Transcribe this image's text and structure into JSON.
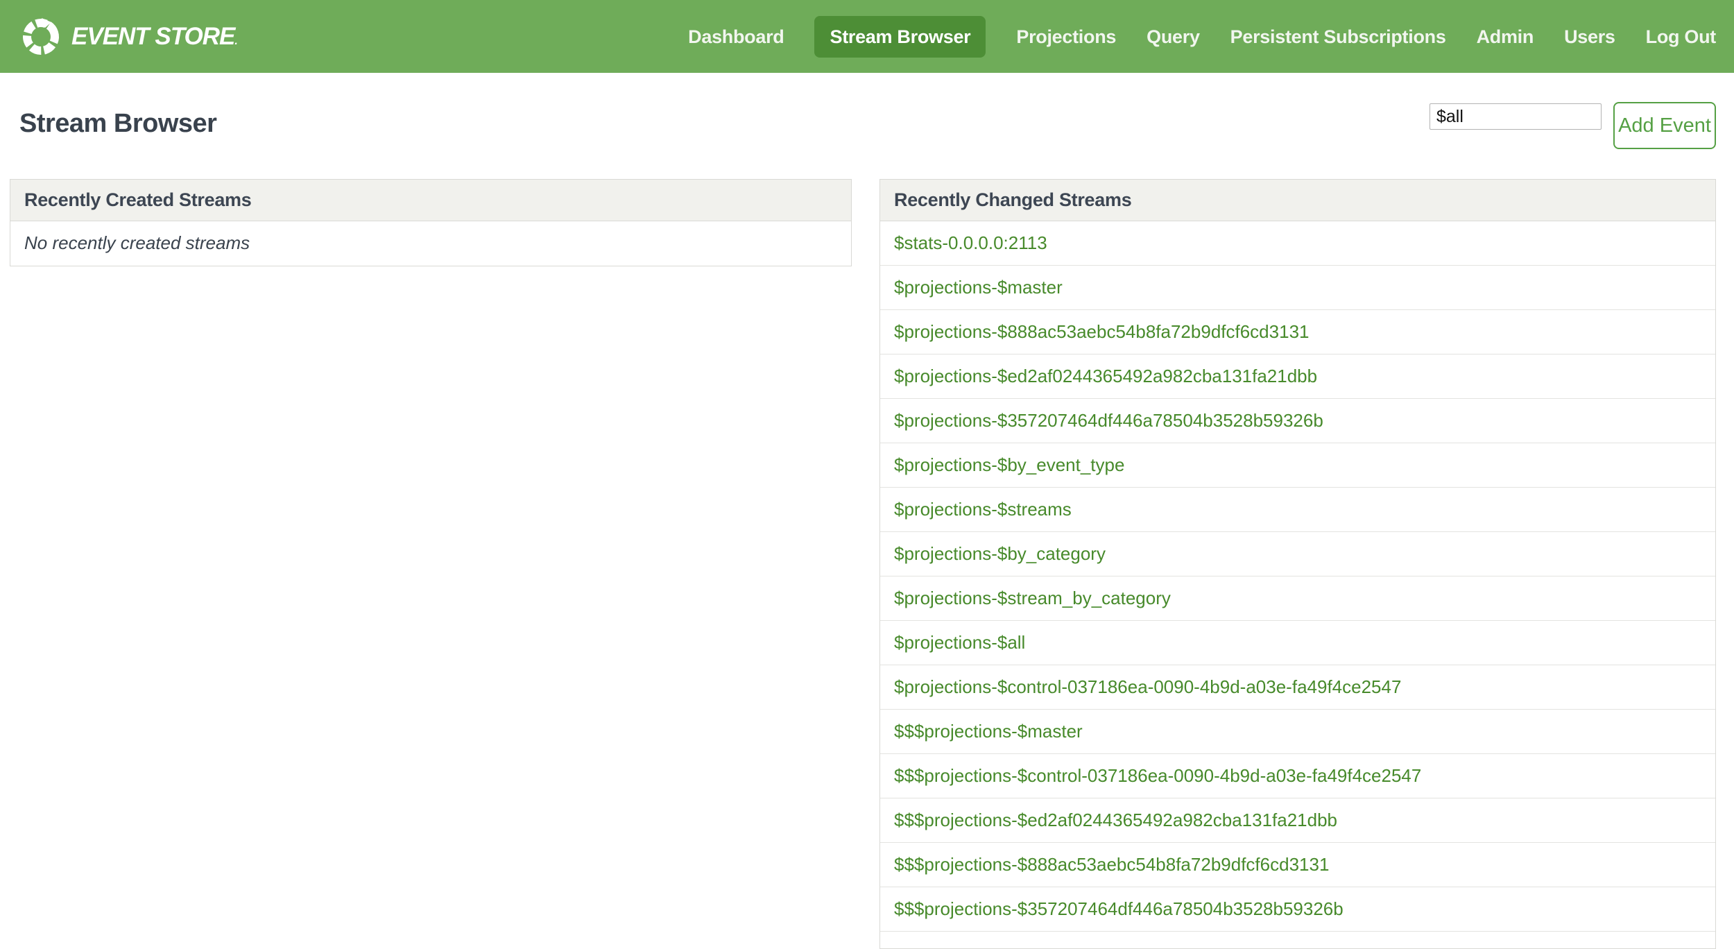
{
  "navbar": {
    "logo_text": "EVENT STORE",
    "logo_mark": ".",
    "items": [
      {
        "label": "Dashboard",
        "active": false
      },
      {
        "label": "Stream Browser",
        "active": true
      },
      {
        "label": "Projections",
        "active": false
      },
      {
        "label": "Query",
        "active": false
      },
      {
        "label": "Persistent Subscriptions",
        "active": false
      },
      {
        "label": "Admin",
        "active": false
      },
      {
        "label": "Users",
        "active": false
      },
      {
        "label": "Log Out",
        "active": false
      }
    ]
  },
  "page": {
    "title": "Stream Browser"
  },
  "toolbar": {
    "stream_input_value": "$all",
    "add_event_label": "Add Event"
  },
  "left_panel": {
    "title": "Recently Created Streams",
    "empty_message": "No recently created streams"
  },
  "right_panel": {
    "title": "Recently Changed Streams",
    "streams": [
      "$stats-0.0.0.0:2113",
      "$projections-$master",
      "$projections-$888ac53aebc54b8fa72b9dfcf6cd3131",
      "$projections-$ed2af0244365492a982cba131fa21dbb",
      "$projections-$357207464df446a78504b3528b59326b",
      "$projections-$by_event_type",
      "$projections-$streams",
      "$projections-$by_category",
      "$projections-$stream_by_category",
      "$projections-$all",
      "$projections-$control-037186ea-0090-4b9d-a03e-fa49f4ce2547",
      "$$$projections-$master",
      "$$$projections-$control-037186ea-0090-4b9d-a03e-fa49f4ce2547",
      "$$$projections-$ed2af0244365492a982cba131fa21dbb",
      "$$$projections-$888ac53aebc54b8fa72b9dfcf6cd3131",
      "$$$projections-$357207464df446a78504b3528b59326b"
    ]
  },
  "colors": {
    "navbar_bg": "#6fac59",
    "active_tab_bg": "#4d8e36",
    "link_green": "#478a2b",
    "button_green": "#55a044",
    "heading_text": "#39424d",
    "panel_header_bg": "#f1f1ed",
    "panel_border": "#d9d9d5"
  }
}
